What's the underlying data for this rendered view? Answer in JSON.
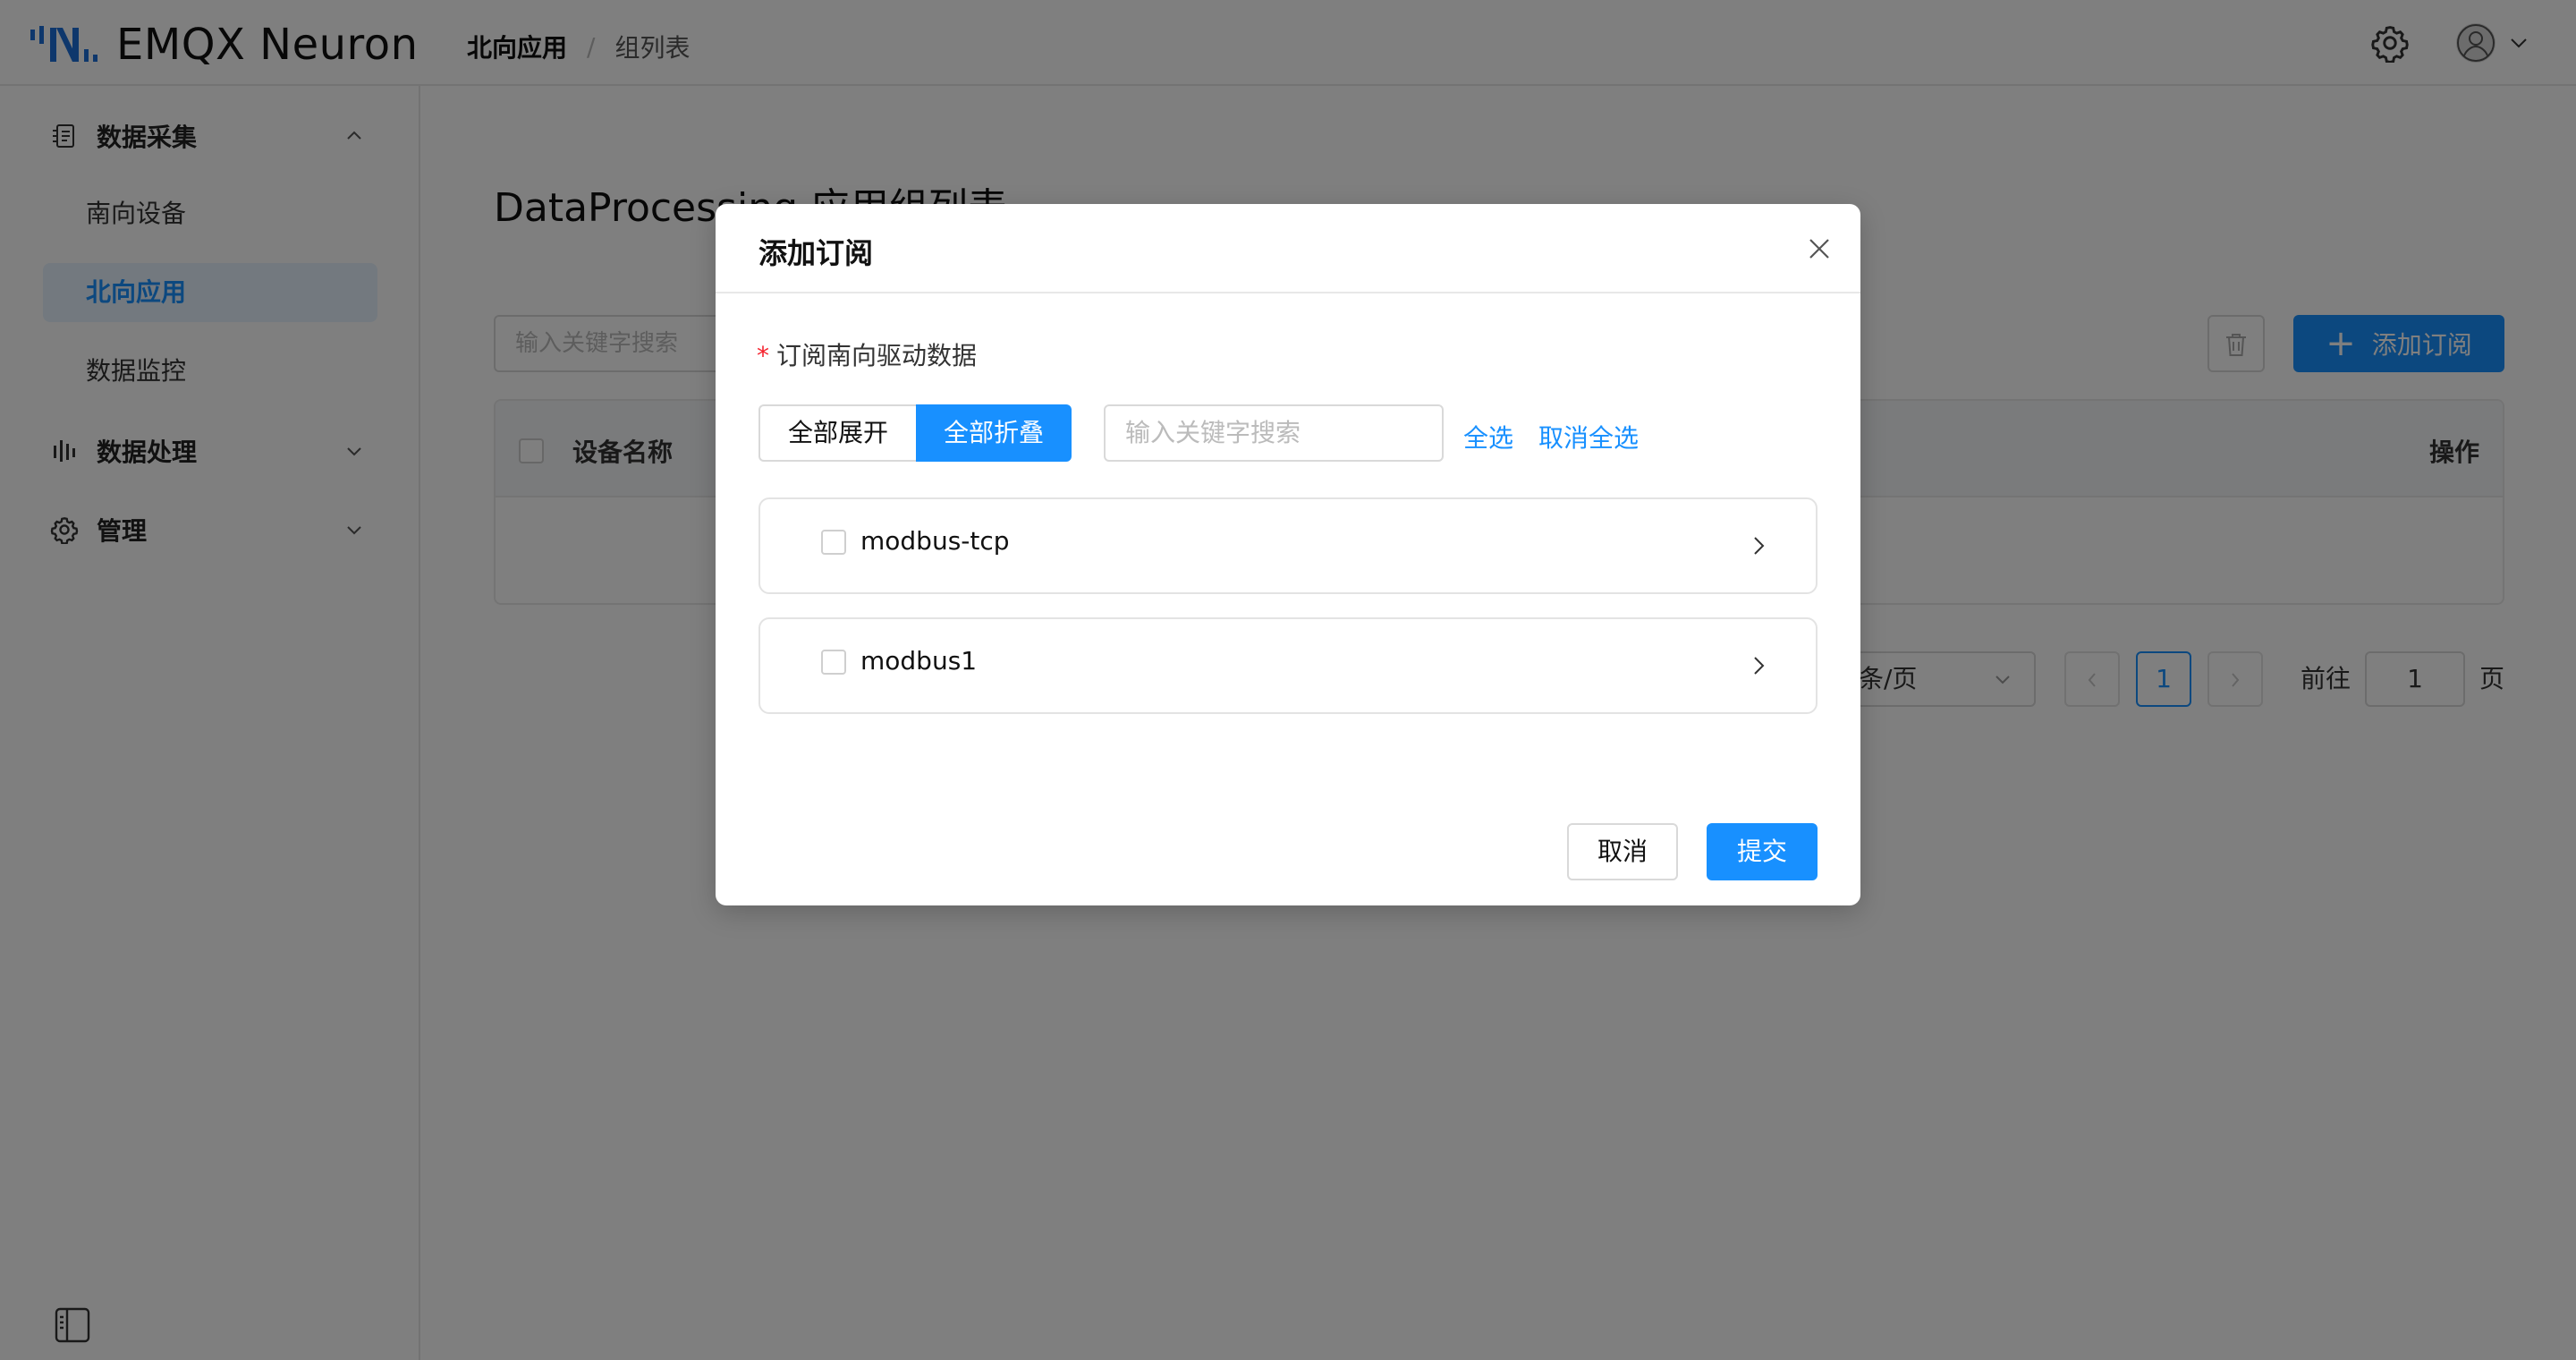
{
  "app": {
    "brand": "EMQX Neuron",
    "breadcrumb": [
      "北向应用",
      "组列表"
    ],
    "breadcrumb_sep": "/"
  },
  "sidebar": {
    "groups": [
      {
        "label": "数据采集",
        "icon": "data-collection-icon",
        "expanded": true,
        "items": [
          {
            "label": "南向设备",
            "active": false
          },
          {
            "label": "北向应用",
            "active": true
          },
          {
            "label": "数据监控",
            "active": false
          }
        ]
      },
      {
        "label": "数据处理",
        "icon": "data-processing-icon",
        "expanded": false
      },
      {
        "label": "管理",
        "icon": "gear-icon",
        "expanded": false
      }
    ]
  },
  "main": {
    "title": "DataProcessing 应用组列表",
    "search_placeholder": "输入关键字搜索",
    "add_button": "添加订阅",
    "table": {
      "columns": [
        "设备名称",
        "操作"
      ]
    },
    "pagination": {
      "page_size_suffix": "条/页",
      "current_page": "1",
      "goto_label": "前往",
      "goto_value": "1",
      "goto_suffix": "页"
    }
  },
  "modal": {
    "title": "添加订阅",
    "field_label": "订阅南向驱动数据",
    "required_mark": "*",
    "expand_all": "全部展开",
    "collapse_all": "全部折叠",
    "search_placeholder": "输入关键字搜索",
    "select_all": "全选",
    "deselect_all": "取消全选",
    "devices": [
      {
        "name": "modbus-tcp",
        "checked": false
      },
      {
        "name": "modbus1",
        "checked": false
      }
    ],
    "cancel": "取消",
    "submit": "提交"
  },
  "colors": {
    "primary": "#1890ff",
    "required": "#f5222d",
    "mask": "rgba(0,0,0,0.5)"
  }
}
